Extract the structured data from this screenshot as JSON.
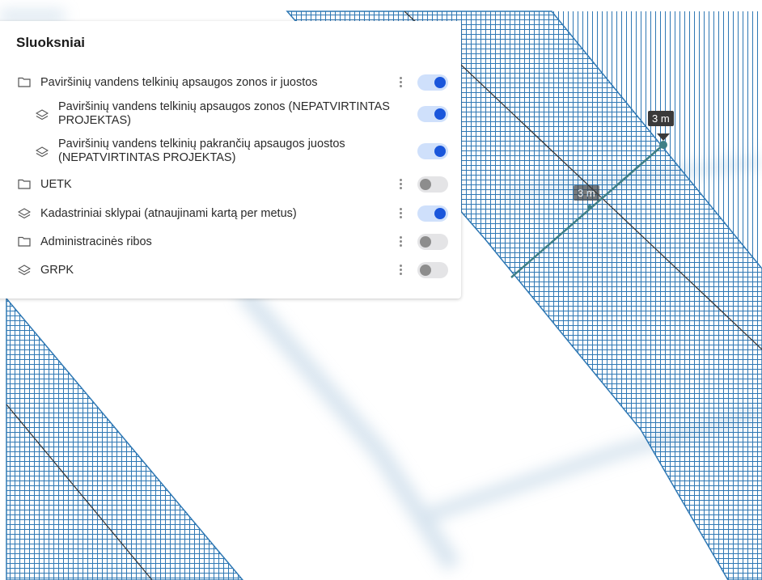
{
  "panel": {
    "title": "Sluoksniai",
    "layers": [
      {
        "label": "Paviršinių vandens telkinių apsaugos zonos ir juostos",
        "icon": "folder-icon",
        "enabled": true,
        "has_menu": true
      },
      {
        "label": "Paviršinių vandens telkinių apsaugos zonos (NEPATVIRTINTAS PROJEKTAS)",
        "icon": "layers-icon",
        "enabled": true,
        "has_menu": false
      },
      {
        "label": "Paviršinių vandens telkinių pakrančių apsaugos juostos (NEPATVIRTINTAS PROJEKTAS)",
        "icon": "layers-icon",
        "enabled": true,
        "has_menu": false
      },
      {
        "label": "UETK",
        "icon": "folder-icon",
        "enabled": false,
        "has_menu": true
      },
      {
        "label": "Kadastriniai sklypai (atnaujinami kartą per metus)",
        "icon": "layers-icon",
        "enabled": true,
        "has_menu": true
      },
      {
        "label": "Administracinės ribos",
        "icon": "folder-icon",
        "enabled": false,
        "has_menu": true
      },
      {
        "label": "GRPK",
        "icon": "layers-icon",
        "enabled": false,
        "has_menu": true
      }
    ]
  },
  "measurement": {
    "label_1": "3 m",
    "label_2": "3 m"
  },
  "colors": {
    "hatch": "#2f78b4",
    "toggle_on": "#1a56db",
    "toggle_on_track": "#cfe0fb",
    "toggle_off_track": "#e4e4e6",
    "measure_line": "#3f7f86"
  }
}
